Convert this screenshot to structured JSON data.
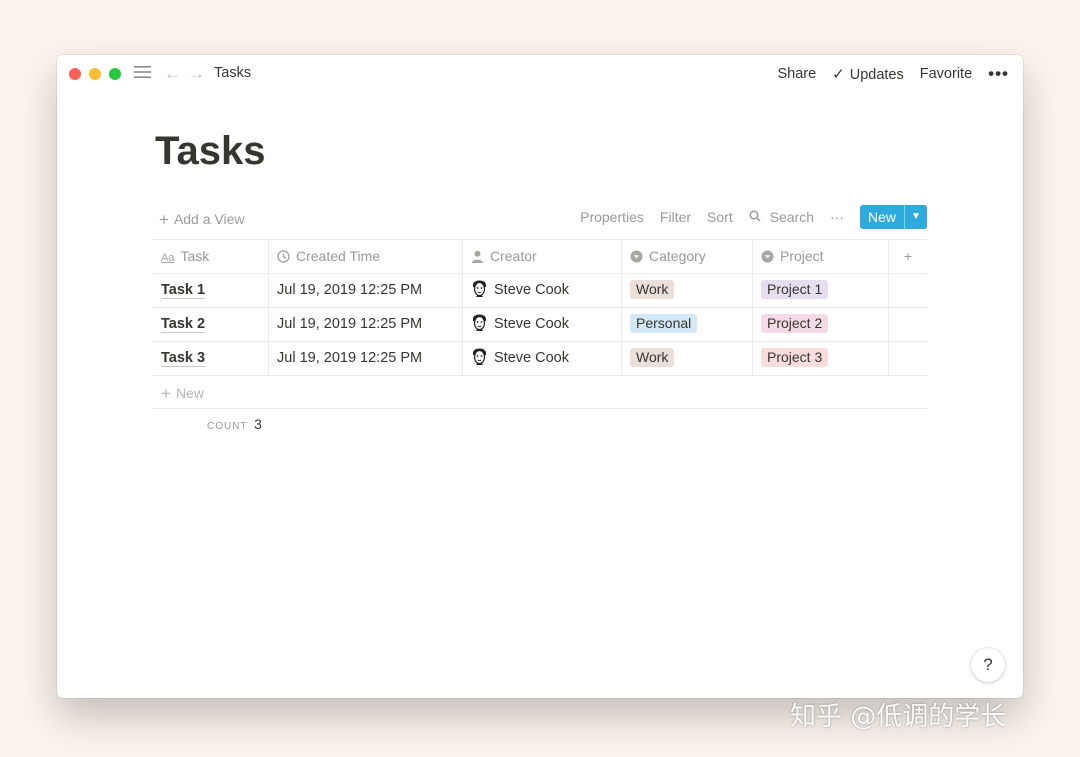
{
  "window": {
    "breadcrumb": "Tasks",
    "icons": {
      "menu": "hamburger-icon",
      "back": "arrow-left-icon",
      "forward": "arrow-right-icon"
    },
    "share_label": "Share",
    "updates_label": "Updates",
    "favorite_label": "Favorite",
    "more_label": "•••"
  },
  "page": {
    "title": "Tasks"
  },
  "viewbar": {
    "add_view_label": "Add a View",
    "properties_label": "Properties",
    "filter_label": "Filter",
    "sort_label": "Sort",
    "search_label": "Search",
    "more_label": "···",
    "new_label": "New"
  },
  "table": {
    "columns": [
      {
        "label": "Task",
        "icon": "text-aa-icon"
      },
      {
        "label": "Created Time",
        "icon": "clock-icon"
      },
      {
        "label": "Creator",
        "icon": "person-icon"
      },
      {
        "label": "Category",
        "icon": "select-icon"
      },
      {
        "label": "Project",
        "icon": "select-icon"
      }
    ],
    "rows": [
      {
        "task": "Task 1",
        "created": "Jul 19, 2019 12:25 PM",
        "creator": "Steve Cook",
        "category": "Work",
        "category_color": "#eadfd9",
        "project": "Project 1",
        "project_color": "#e6ddf0"
      },
      {
        "task": "Task 2",
        "created": "Jul 19, 2019 12:25 PM",
        "creator": "Steve Cook",
        "category": "Personal",
        "category_color": "#d3e8f6",
        "project": "Project 2",
        "project_color": "#f4dbe7"
      },
      {
        "task": "Task 3",
        "created": "Jul 19, 2019 12:25 PM",
        "creator": "Steve Cook",
        "category": "Work",
        "category_color": "#eadfd9",
        "project": "Project 3",
        "project_color": "#fadcdc"
      }
    ],
    "new_row_label": "New",
    "count_label": "COUNT",
    "count_value": "3"
  },
  "help_label": "?",
  "watermark": "知乎 @低调的学长"
}
